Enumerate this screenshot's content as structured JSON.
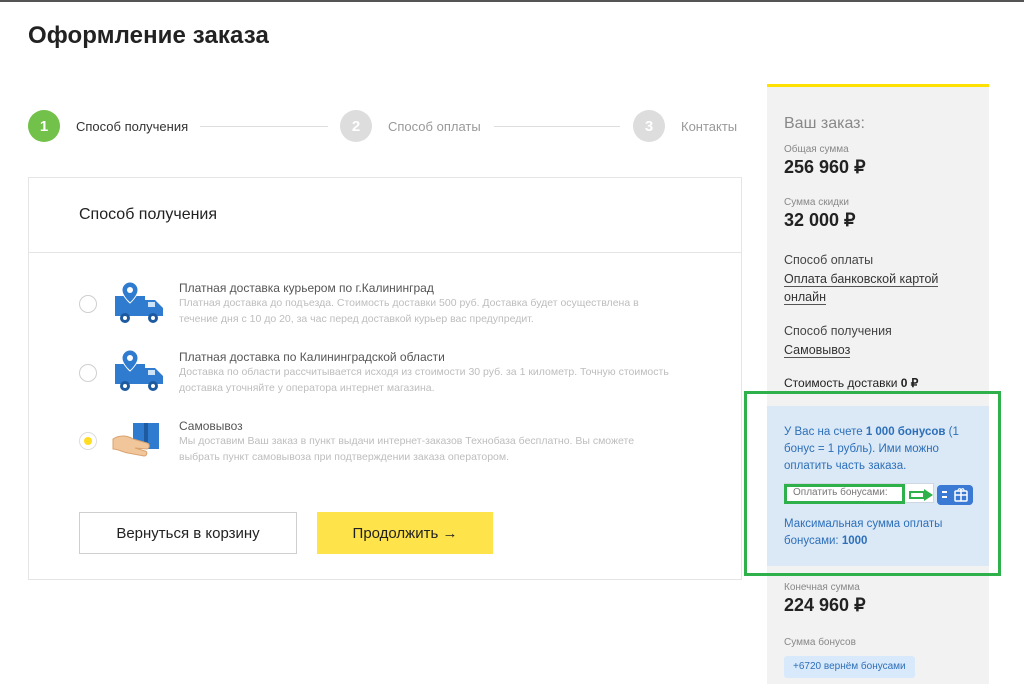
{
  "page": {
    "title": "Оформление заказа"
  },
  "steps": [
    {
      "number": "1",
      "label": "Способ получения",
      "active": true
    },
    {
      "number": "2",
      "label": "Способ оплаты",
      "active": false
    },
    {
      "number": "3",
      "label": "Контакты",
      "active": false
    }
  ],
  "delivery": {
    "heading": "Способ получения",
    "options": [
      {
        "title": "Платная доставка курьером по г.Калининград",
        "description": "Платная доставка до подъезда. Стоимость доставки 500 руб. Доставка будет осуществлена в течение дня с 10 до 20, за час перед доставкой курьер вас предупредит.",
        "icon": "delivery-truck-icon",
        "selected": false
      },
      {
        "title": "Платная доставка по Калининградской области",
        "description": "Доставка по области рассчитывается исходя из стоимости 30 руб. за 1 километр. Точную стоимость доставка уточняйте у оператора интернет магазина.",
        "icon": "delivery-truck-icon",
        "selected": false
      },
      {
        "title": "Самовывоз",
        "description": "Мы доставим Ваш заказ в пункт выдачи интернет-заказов Технобаза бесплатно. Вы сможете выбрать пункт самовывоза при подтверждении заказа оператором.",
        "icon": "hand-box-icon",
        "selected": true
      }
    ],
    "back_label": "Вернуться в корзину",
    "next_label": "Продолжить →"
  },
  "order": {
    "title": "Ваш заказ:",
    "total_label": "Общая сумма",
    "total_value": "256 960 ₽",
    "discount_label": "Сумма скидки",
    "discount_value": "32 000 ₽",
    "payment_label": "Способ оплаты",
    "payment_value": "Оплата банковской картой онлайн",
    "pickup_label": "Способ получения",
    "pickup_value": "Самовывоз",
    "shipping_label": "Стоимость доставки",
    "shipping_value": "0 ₽",
    "bonus": {
      "info_prefix": "У Вас на счете ",
      "info_amount": "1 000 бонусов",
      "info_suffix": " (1 бонус = 1 рубль). Ими можно оплатить часть заказа.",
      "input_placeholder": "Оплатить бонусами:",
      "max_text": "Максимальная сумма оплаты бонусами: ",
      "max_value": "1000"
    },
    "final_label": "Конечная сумма",
    "final_value": "224 960 ₽",
    "bonus_sum_label": "Сумма бонусов",
    "bonus_return": "+6720 вернём бонусами"
  },
  "colors": {
    "accent_yellow": "#ffe34a",
    "step_active": "#72c14a",
    "bonus_text": "#2d6fb9",
    "highlight_green": "#2eb04a"
  }
}
